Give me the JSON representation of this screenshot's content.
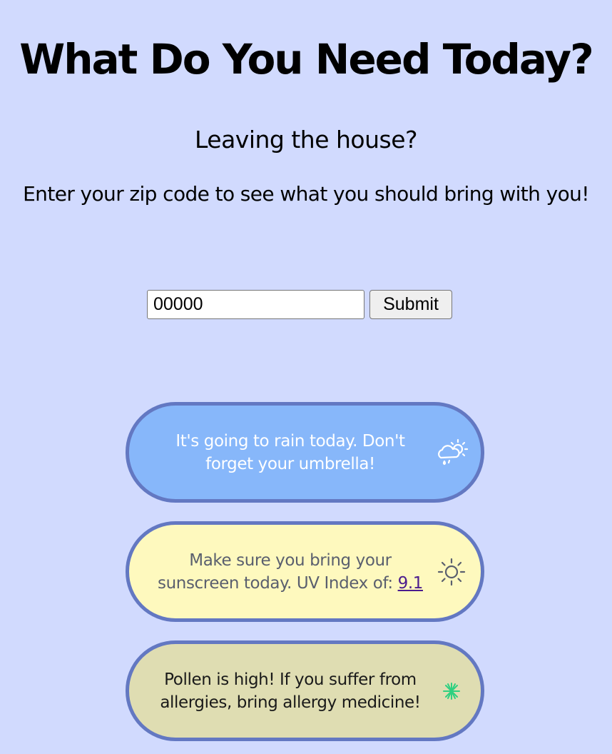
{
  "header": {
    "title": "What Do You Need Today?",
    "subtitle": "Leaving the house?",
    "instructions": "Enter your zip code to see what you should bring with you!"
  },
  "form": {
    "zip_value": "00000",
    "submit_label": "Submit"
  },
  "cards": {
    "rain": {
      "text": "It's going to rain today. Don't forget your umbrella!",
      "icon": "rain-cloud-sun-icon",
      "background": "#87b7fa"
    },
    "sun": {
      "text_prefix": "Make sure you bring your sunscreen today. UV Index of:",
      "uv_index": "9.1",
      "icon": "sun-icon",
      "background": "#fef9be"
    },
    "pollen": {
      "text": "Pollen is high! If you suffer from allergies, bring allergy medicine!",
      "icon": "pollen-icon",
      "background": "#dfddb2",
      "icon_color": "#2fd080"
    }
  },
  "colors": {
    "page_background": "#d1dafe",
    "card_border": "#6378c2",
    "link": "#4b1c8e"
  }
}
